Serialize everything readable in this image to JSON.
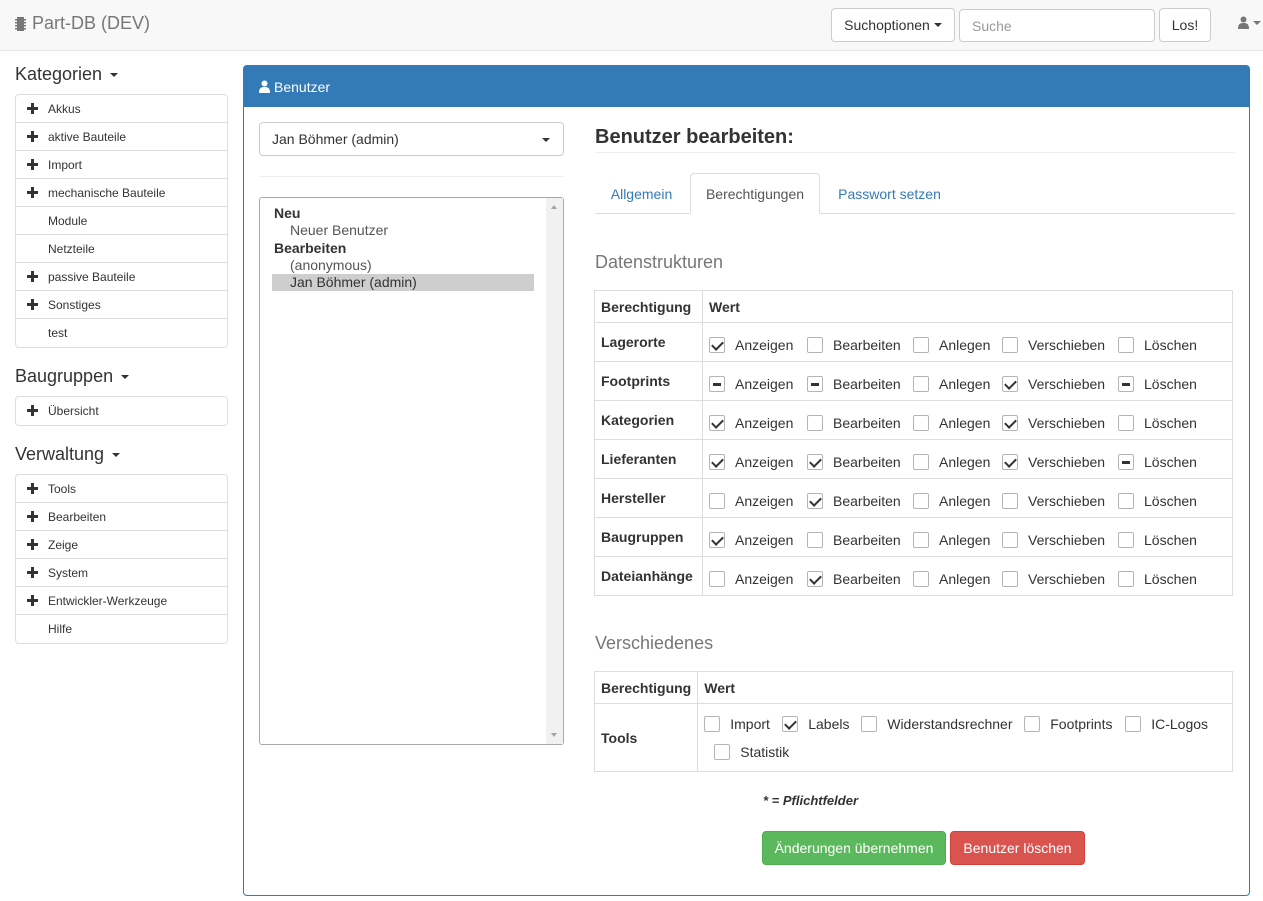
{
  "navbar": {
    "brand": "Part-DB (DEV)",
    "search_options_label": "Suchoptionen",
    "search_placeholder": "Suche",
    "search_value": "",
    "go_label": "Los!"
  },
  "sidebar": {
    "categories": {
      "heading": "Kategorien",
      "items": [
        {
          "label": "Akkus",
          "expandable": true
        },
        {
          "label": "aktive Bauteile",
          "expandable": true
        },
        {
          "label": "Import",
          "expandable": true
        },
        {
          "label": "mechanische Bauteile",
          "expandable": true
        },
        {
          "label": "Module",
          "expandable": false
        },
        {
          "label": "Netzteile",
          "expandable": false
        },
        {
          "label": "passive Bauteile",
          "expandable": true
        },
        {
          "label": "Sonstiges",
          "expandable": true
        },
        {
          "label": "test",
          "expandable": false
        }
      ]
    },
    "assemblies": {
      "heading": "Baugruppen",
      "items": [
        {
          "label": "Übersicht",
          "expandable": true
        }
      ]
    },
    "admin": {
      "heading": "Verwaltung",
      "items": [
        {
          "label": "Tools",
          "expandable": true
        },
        {
          "label": "Bearbeiten",
          "expandable": true
        },
        {
          "label": "Zeige",
          "expandable": true
        },
        {
          "label": "System",
          "expandable": true
        },
        {
          "label": "Entwickler-Werkzeuge",
          "expandable": true
        },
        {
          "label": "Hilfe",
          "expandable": false
        }
      ]
    }
  },
  "panel": {
    "title": "Benutzer",
    "selected_user": "Jan Böhmer (admin)",
    "listbox": {
      "groups": [
        {
          "label": "Neu",
          "options": [
            {
              "label": "Neuer Benutzer",
              "selected": false
            }
          ]
        },
        {
          "label": "Bearbeiten",
          "options": [
            {
              "label": "(anonymous)",
              "selected": false
            },
            {
              "label": "Jan Böhmer (admin)",
              "selected": true
            }
          ]
        }
      ]
    },
    "edit_title": "Benutzer bearbeiten:",
    "tabs": [
      {
        "label": "Allgemein",
        "active": false
      },
      {
        "label": "Berechtigungen",
        "active": true
      },
      {
        "label": "Passwort setzen",
        "active": false
      }
    ],
    "data_structures": {
      "title": "Datenstrukturen",
      "header_permission": "Berechtigung",
      "header_value": "Wert",
      "option_labels": [
        "Anzeigen",
        "Bearbeiten",
        "Anlegen",
        "Verschieben",
        "Löschen"
      ],
      "rows": [
        {
          "label": "Lagerorte",
          "states": [
            "checked",
            "unchecked",
            "unchecked",
            "unchecked",
            "unchecked"
          ]
        },
        {
          "label": "Footprints",
          "states": [
            "indeterminate",
            "indeterminate",
            "unchecked",
            "checked",
            "indeterminate"
          ]
        },
        {
          "label": "Kategorien",
          "states": [
            "checked",
            "unchecked",
            "unchecked",
            "checked",
            "unchecked"
          ]
        },
        {
          "label": "Lieferanten",
          "states": [
            "checked",
            "checked",
            "unchecked",
            "checked",
            "indeterminate"
          ]
        },
        {
          "label": "Hersteller",
          "states": [
            "unchecked",
            "checked",
            "unchecked",
            "unchecked",
            "unchecked"
          ]
        },
        {
          "label": "Baugruppen",
          "states": [
            "checked",
            "unchecked",
            "unchecked",
            "unchecked",
            "unchecked"
          ]
        },
        {
          "label": "Dateianhänge",
          "states": [
            "unchecked",
            "checked",
            "unchecked",
            "unchecked",
            "unchecked"
          ]
        }
      ]
    },
    "misc": {
      "title": "Verschiedenes",
      "header_permission": "Berechtigung",
      "header_value": "Wert",
      "row_label": "Tools",
      "options": [
        {
          "label": "Import",
          "state": "unchecked"
        },
        {
          "label": "Labels",
          "state": "checked"
        },
        {
          "label": "Widerstandsrechner",
          "state": "unchecked"
        },
        {
          "label": "Footprints",
          "state": "unchecked"
        },
        {
          "label": "IC-Logos",
          "state": "unchecked"
        },
        {
          "label": "Statistik",
          "state": "unchecked"
        }
      ]
    },
    "required_note": "* = Pflichtfelder",
    "apply_label": "Änderungen übernehmen",
    "delete_label": "Benutzer löschen"
  }
}
